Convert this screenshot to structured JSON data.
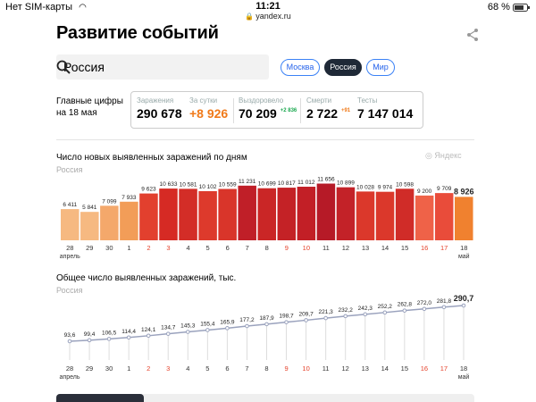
{
  "status": {
    "carrier": "Нет SIM-карты",
    "time": "11:21",
    "url": "yandex.ru",
    "battery": "68 %"
  },
  "title": "Развитие событий",
  "search": {
    "value": "Россия"
  },
  "pills": [
    {
      "label": "Москва",
      "active": false
    },
    {
      "label": "Россия",
      "active": true
    },
    {
      "label": "Мир",
      "active": false
    }
  ],
  "main_figures": {
    "label_line1": "Главные цифры",
    "label_line2": "на 18 мая",
    "items": [
      {
        "label": "Заражения",
        "value": "290 678",
        "delta": ""
      },
      {
        "label": "За сутки",
        "value": "+8 926",
        "delta": ""
      },
      {
        "label": "Выздоровело",
        "value": "70 209",
        "delta": "+2 836"
      },
      {
        "label": "Смерти",
        "value": "2 722",
        "delta": "+91"
      },
      {
        "label": "Тесты",
        "value": "7 147 014",
        "delta": ""
      }
    ]
  },
  "watermark": "Яндекс",
  "chart_data": [
    {
      "type": "bar",
      "title": "Число новых выявленных заражений по дням",
      "subtitle": "Россия",
      "categories": [
        "28",
        "29",
        "30",
        "1",
        "2",
        "3",
        "4",
        "5",
        "6",
        "7",
        "8",
        "9",
        "10",
        "11",
        "12",
        "13",
        "14",
        "15",
        "16",
        "17",
        "18"
      ],
      "month_labels": [
        "апрель",
        "май"
      ],
      "values": [
        6411,
        5841,
        7099,
        7933,
        9623,
        10633,
        10581,
        10102,
        10559,
        11231,
        10699,
        10817,
        11012,
        11656,
        10899,
        10028,
        9974,
        10598,
        9200,
        9709,
        8926
      ],
      "value_labels": [
        "6 411",
        "5 841",
        "7 099",
        "7 933",
        "9 623",
        "10 633",
        "10 581",
        "10 102",
        "10 559",
        "11 231",
        "10 699",
        "10 817",
        "11 012",
        "11 656",
        "10 899",
        "10 028",
        "9 974",
        "10 598",
        "9 200",
        "9 709",
        "8 926"
      ],
      "holiday_categories": [
        "2",
        "3",
        "9",
        "10",
        "16",
        "17"
      ],
      "colors": [
        "#f6b981",
        "#f6b981",
        "#f4a86b",
        "#f29d58",
        "#e2402e",
        "#d62a24",
        "#d32d27",
        "#dd3a2c",
        "#d9352a",
        "#c01f28",
        "#ca2626",
        "#c42226",
        "#c21f26",
        "#b61a27",
        "#c32228",
        "#db382b",
        "#db382b",
        "#d02c28",
        "#ef6248",
        "#e94c3a",
        "#f0812f"
      ]
    },
    {
      "type": "line",
      "title": "Общее число выявленных заражений, тыс.",
      "subtitle": "Россия",
      "categories": [
        "28",
        "29",
        "30",
        "1",
        "2",
        "3",
        "4",
        "5",
        "6",
        "7",
        "8",
        "9",
        "10",
        "11",
        "12",
        "13",
        "14",
        "15",
        "16",
        "17",
        "18"
      ],
      "month_labels": [
        "апрель",
        "май"
      ],
      "values": [
        93.6,
        99.4,
        106.5,
        114.4,
        124.1,
        134.7,
        145.3,
        155.4,
        165.9,
        177.2,
        187.9,
        198.7,
        209.7,
        221.3,
        232.2,
        242.3,
        252.2,
        262.8,
        272.0,
        281.8,
        290.7
      ],
      "value_labels": [
        "93,6",
        "99,4",
        "106,5",
        "114,4",
        "124,1",
        "134,7",
        "145,3",
        "155,4",
        "165,9",
        "177,2",
        "187,9",
        "198,7",
        "209,7",
        "221,3",
        "232,2",
        "242,3",
        "252,2",
        "262,8",
        "272,0",
        "281,8",
        "290,7"
      ],
      "holiday_categories": [
        "2",
        "3",
        "9",
        "10",
        "16",
        "17"
      ],
      "line_color": "#9aa2bd"
    }
  ]
}
